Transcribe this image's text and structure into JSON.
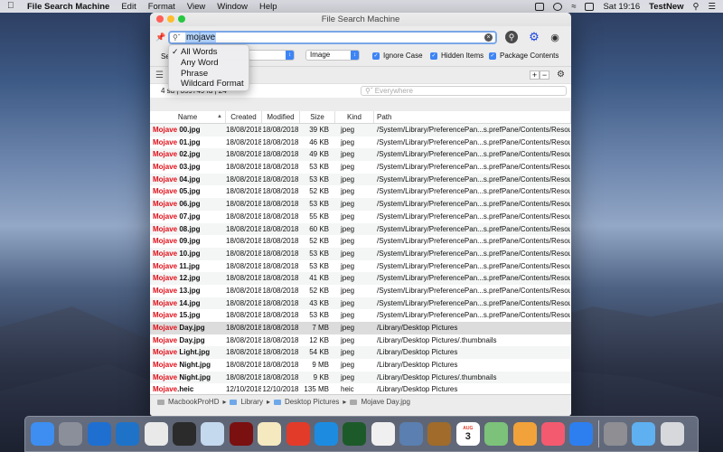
{
  "menubar": {
    "app_name": "File Search Machine",
    "items": [
      "Edit",
      "Format",
      "View",
      "Window",
      "Help"
    ],
    "clock": "Sat 19:16",
    "user": "TestNew"
  },
  "window": {
    "title": "File Search Machine"
  },
  "search": {
    "value": "mojave"
  },
  "options": {
    "mode_label_partial": "Se",
    "kind_selected": "Image",
    "ignore_case_label": "Ignore Case",
    "hidden_items_label": "Hidden Items",
    "package_contents_label": "Package Contents",
    "ignore_case_checked": true,
    "hidden_items_checked": true,
    "package_contents_checked": true
  },
  "dropdown": {
    "items": [
      "All Words",
      "Any Word",
      "Phrase",
      "Wildcard Format"
    ],
    "checked_index": 0
  },
  "status": {
    "text": "4 sd  |  359749 fd  |  24",
    "filter_placeholder": "Everywhere"
  },
  "table": {
    "columns": [
      "Name",
      "Created",
      "Modified",
      "Size",
      "Kind",
      "Path"
    ],
    "sort_column": "Name",
    "rows": [
      {
        "hl": "Mojave",
        "rest": " 00.jpg",
        "created": "18/08/2018",
        "modified": "18/08/2018",
        "size": "39 KB",
        "kind": "jpeg",
        "path": "/System/Library/PreferencePan...s.prefPane/Contents/Resources"
      },
      {
        "hl": "Mojave",
        "rest": " 01.jpg",
        "created": "18/08/2018",
        "modified": "18/08/2018",
        "size": "46 KB",
        "kind": "jpeg",
        "path": "/System/Library/PreferencePan...s.prefPane/Contents/Resources"
      },
      {
        "hl": "Mojave",
        "rest": " 02.jpg",
        "created": "18/08/2018",
        "modified": "18/08/2018",
        "size": "49 KB",
        "kind": "jpeg",
        "path": "/System/Library/PreferencePan...s.prefPane/Contents/Resources"
      },
      {
        "hl": "Mojave",
        "rest": " 03.jpg",
        "created": "18/08/2018",
        "modified": "18/08/2018",
        "size": "53 KB",
        "kind": "jpeg",
        "path": "/System/Library/PreferencePan...s.prefPane/Contents/Resources"
      },
      {
        "hl": "Mojave",
        "rest": " 04.jpg",
        "created": "18/08/2018",
        "modified": "18/08/2018",
        "size": "53 KB",
        "kind": "jpeg",
        "path": "/System/Library/PreferencePan...s.prefPane/Contents/Resources"
      },
      {
        "hl": "Mojave",
        "rest": " 05.jpg",
        "created": "18/08/2018",
        "modified": "18/08/2018",
        "size": "52 KB",
        "kind": "jpeg",
        "path": "/System/Library/PreferencePan...s.prefPane/Contents/Resources"
      },
      {
        "hl": "Mojave",
        "rest": " 06.jpg",
        "created": "18/08/2018",
        "modified": "18/08/2018",
        "size": "53 KB",
        "kind": "jpeg",
        "path": "/System/Library/PreferencePan...s.prefPane/Contents/Resources"
      },
      {
        "hl": "Mojave",
        "rest": " 07.jpg",
        "created": "18/08/2018",
        "modified": "18/08/2018",
        "size": "55 KB",
        "kind": "jpeg",
        "path": "/System/Library/PreferencePan...s.prefPane/Contents/Resources"
      },
      {
        "hl": "Mojave",
        "rest": " 08.jpg",
        "created": "18/08/2018",
        "modified": "18/08/2018",
        "size": "60 KB",
        "kind": "jpeg",
        "path": "/System/Library/PreferencePan...s.prefPane/Contents/Resources"
      },
      {
        "hl": "Mojave",
        "rest": " 09.jpg",
        "created": "18/08/2018",
        "modified": "18/08/2018",
        "size": "52 KB",
        "kind": "jpeg",
        "path": "/System/Library/PreferencePan...s.prefPane/Contents/Resources"
      },
      {
        "hl": "Mojave",
        "rest": " 10.jpg",
        "created": "18/08/2018",
        "modified": "18/08/2018",
        "size": "53 KB",
        "kind": "jpeg",
        "path": "/System/Library/PreferencePan...s.prefPane/Contents/Resources"
      },
      {
        "hl": "Mojave",
        "rest": " 11.jpg",
        "created": "18/08/2018",
        "modified": "18/08/2018",
        "size": "53 KB",
        "kind": "jpeg",
        "path": "/System/Library/PreferencePan...s.prefPane/Contents/Resources"
      },
      {
        "hl": "Mojave",
        "rest": " 12.jpg",
        "created": "18/08/2018",
        "modified": "18/08/2018",
        "size": "41 KB",
        "kind": "jpeg",
        "path": "/System/Library/PreferencePan...s.prefPane/Contents/Resources"
      },
      {
        "hl": "Mojave",
        "rest": " 13.jpg",
        "created": "18/08/2018",
        "modified": "18/08/2018",
        "size": "52 KB",
        "kind": "jpeg",
        "path": "/System/Library/PreferencePan...s.prefPane/Contents/Resources"
      },
      {
        "hl": "Mojave",
        "rest": " 14.jpg",
        "created": "18/08/2018",
        "modified": "18/08/2018",
        "size": "43 KB",
        "kind": "jpeg",
        "path": "/System/Library/PreferencePan...s.prefPane/Contents/Resources"
      },
      {
        "hl": "Mojave",
        "rest": " 15.jpg",
        "created": "18/08/2018",
        "modified": "18/08/2018",
        "size": "53 KB",
        "kind": "jpeg",
        "path": "/System/Library/PreferencePan...s.prefPane/Contents/Resources"
      },
      {
        "hl": "Mojave",
        "rest": " Day.jpg",
        "created": "18/08/2018",
        "modified": "18/08/2018",
        "size": "7 MB",
        "kind": "jpeg",
        "path": "/Library/Desktop Pictures",
        "selected": true
      },
      {
        "hl": "Mojave",
        "rest": " Day.jpg",
        "created": "18/08/2018",
        "modified": "18/08/2018",
        "size": "12 KB",
        "kind": "jpeg",
        "path": "/Library/Desktop Pictures/.thumbnails"
      },
      {
        "hl": "Mojave",
        "rest": " Light.jpg",
        "created": "18/08/2018",
        "modified": "18/08/2018",
        "size": "54 KB",
        "kind": "jpeg",
        "path": "/Library/Desktop Pictures"
      },
      {
        "hl": "Mojave",
        "rest": " Night.jpg",
        "created": "18/08/2018",
        "modified": "18/08/2018",
        "size": "9 MB",
        "kind": "jpeg",
        "path": "/Library/Desktop Pictures"
      },
      {
        "hl": "Mojave",
        "rest": " Night.jpg",
        "created": "18/08/2018",
        "modified": "18/08/2018",
        "size": "9 KB",
        "kind": "jpeg",
        "path": "/Library/Desktop Pictures/.thumbnails"
      },
      {
        "hl": "Mojave",
        "rest": ".heic",
        "created": "12/10/2018",
        "modified": "12/10/2018",
        "size": "135 MB",
        "kind": "heic",
        "path": "/Library/Desktop Pictures"
      }
    ]
  },
  "pathbar": {
    "segments": [
      "MacbookProHD",
      "Library",
      "Desktop Pictures",
      "Mojave Day.jpg"
    ]
  },
  "dock": {
    "items": [
      {
        "icon": "finder-icon",
        "color": "#3d8ef0"
      },
      {
        "icon": "launchpad-icon",
        "color": "#8a8f9a"
      },
      {
        "icon": "file-search-machine-icon",
        "color": "#1f6fd1"
      },
      {
        "icon": "sync-icon",
        "color": "#1e73c8"
      },
      {
        "icon": "exposure-icon",
        "color": "#e9e9e9"
      },
      {
        "icon": "recycle-icon",
        "color": "#2b2b2b"
      },
      {
        "icon": "preview-icon",
        "color": "#c4d8ee"
      },
      {
        "icon": "trash-app-icon",
        "color": "#7a1010"
      },
      {
        "icon": "text-app-icon",
        "color": "#f5e9c0"
      },
      {
        "icon": "fork-icon",
        "color": "#e23b2a"
      },
      {
        "icon": "settings-app-icon",
        "color": "#1d8ce0"
      },
      {
        "icon": "vpn-icon",
        "color": "#1d5a2a"
      },
      {
        "icon": "compass-icon",
        "color": "#f0f0f0"
      },
      {
        "icon": "photo-icon",
        "color": "#5a7fb0"
      },
      {
        "icon": "notebook-icon",
        "color": "#a06b2b"
      },
      {
        "icon": "calendar-icon",
        "color": "#ffffff"
      },
      {
        "icon": "maps-icon",
        "color": "#7cc27a"
      },
      {
        "icon": "photos-icon",
        "color": "#f2a23a"
      },
      {
        "icon": "music-icon",
        "color": "#f35a6f"
      },
      {
        "icon": "app-store-icon",
        "color": "#2d7ff0"
      },
      {
        "icon": "system-preferences-icon",
        "color": "#8e8e93"
      },
      {
        "icon": "downloads-folder-icon",
        "color": "#5eb0f0"
      },
      {
        "icon": "trash-icon",
        "color": "#d6d8dc"
      }
    ],
    "calendar_month": "AUG",
    "calendar_day": "3"
  }
}
